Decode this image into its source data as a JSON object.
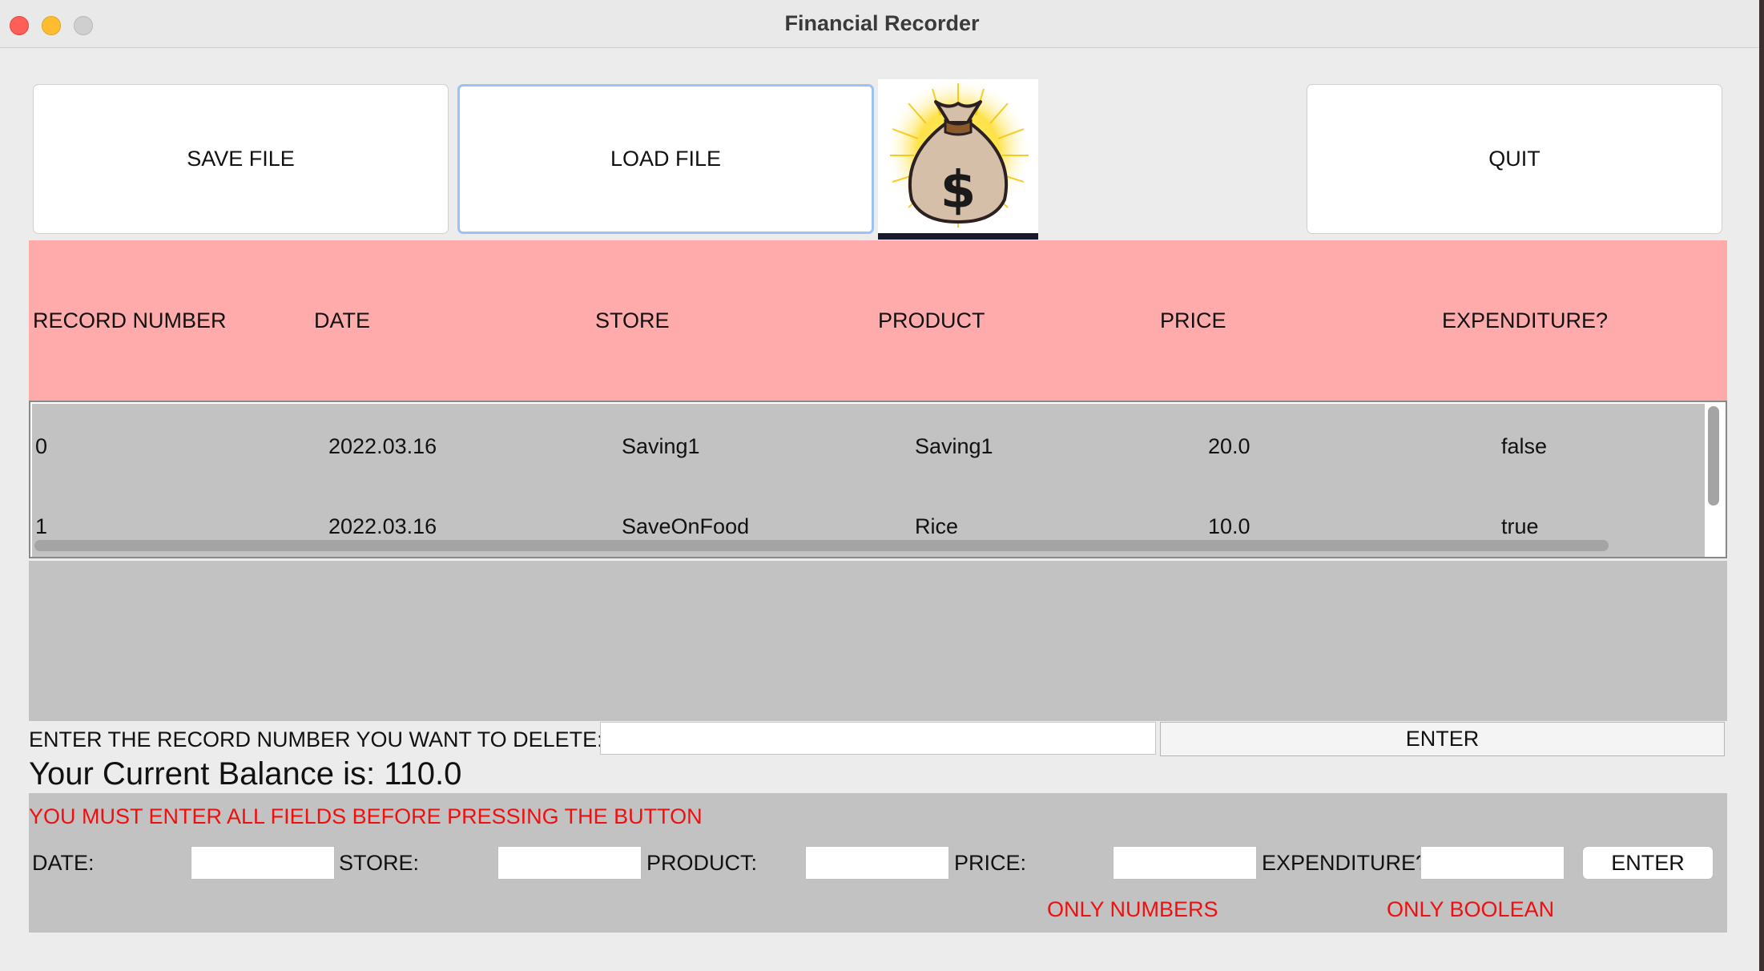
{
  "window": {
    "title": "Financial Recorder"
  },
  "toolbar": {
    "save_label": "SAVE FILE",
    "load_label": "LOAD FILE",
    "quit_label": "QUIT",
    "logo_icon": "money-bag-icon"
  },
  "table": {
    "headers": [
      "RECORD NUMBER",
      "DATE",
      "STORE",
      "PRODUCT",
      "PRICE",
      "EXPENDITURE?"
    ],
    "rows": [
      [
        "0",
        "2022.03.16",
        "Saving1",
        "Saving1",
        "20.0",
        "false"
      ],
      [
        "1",
        "2022.03.16",
        "SaveOnFood",
        "Rice",
        "10.0",
        "true"
      ]
    ]
  },
  "delete": {
    "label": "ENTER THE RECORD NUMBER YOU WANT TO DELETE:",
    "value": "",
    "enter_label": "ENTER"
  },
  "balance": {
    "text": "Your Current Balance is: 110.0"
  },
  "form": {
    "warning": "YOU MUST ENTER ALL FIELDS BEFORE PRESSING THE BUTTON",
    "date_label": "DATE:",
    "store_label": "STORE:",
    "product_label": "PRODUCT:",
    "price_label": "PRICE:",
    "expenditure_label": "EXPENDITURE?",
    "enter_label": "ENTER",
    "price_hint": "ONLY NUMBERS",
    "expenditure_hint": "ONLY BOOLEAN"
  },
  "colors": {
    "header_bg": "#ffabab",
    "panel_bg": "#c2c2c2",
    "warning": "#ee1010",
    "focus_border": "#9cc2ef"
  }
}
